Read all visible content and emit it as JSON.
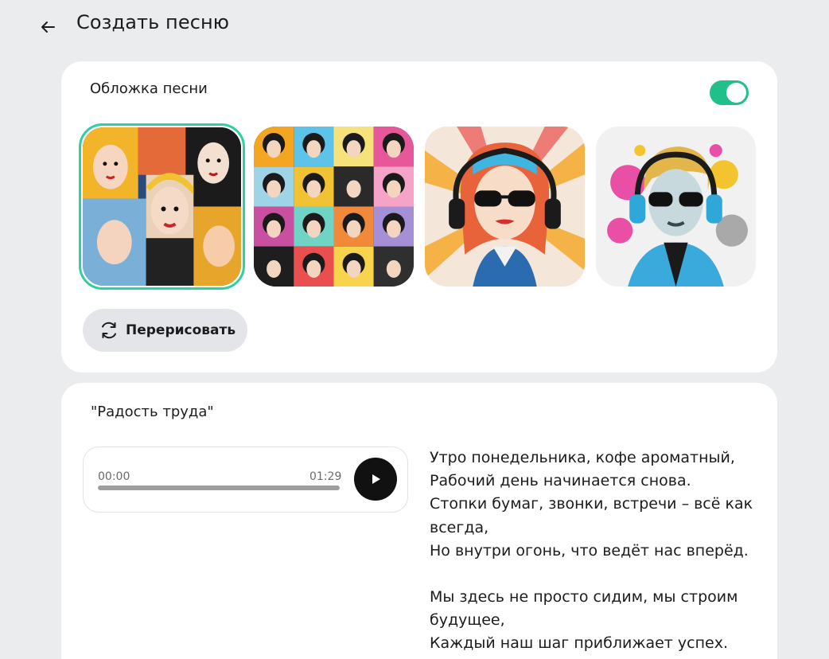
{
  "header": {
    "title": "Создать песню",
    "back_icon": "arrow-left-icon"
  },
  "cover": {
    "label": "Обложка песни",
    "toggle_on": true,
    "accent": "#21c08b",
    "thumbnails": [
      {
        "name": "pop-art-collage-women",
        "selected": true
      },
      {
        "name": "pop-art-grid-portraits",
        "selected": false
      },
      {
        "name": "woman-headphones-sunglasses-red-hair",
        "selected": false
      },
      {
        "name": "woman-headphones-blonde-blue-jacket",
        "selected": false
      }
    ],
    "redraw_label": "Перерисовать",
    "redraw_icon": "refresh-icon"
  },
  "song": {
    "title": "\"Радость труда\"",
    "player": {
      "current_time": "00:00",
      "duration": "01:29",
      "progress": 0,
      "play_icon": "play-icon"
    },
    "lyrics": [
      [
        "Утро понедельника, кофе ароматный,",
        "Рабочий день начинается снова.",
        "Стопки бумаг, звонки, встречи – всё как всегда,",
        "Но внутри огонь, что ведёт нас вперёд."
      ],
      [
        "Мы здесь не просто сидим, мы строим будущее,",
        "Каждый наш шаг приближает успех."
      ]
    ]
  }
}
